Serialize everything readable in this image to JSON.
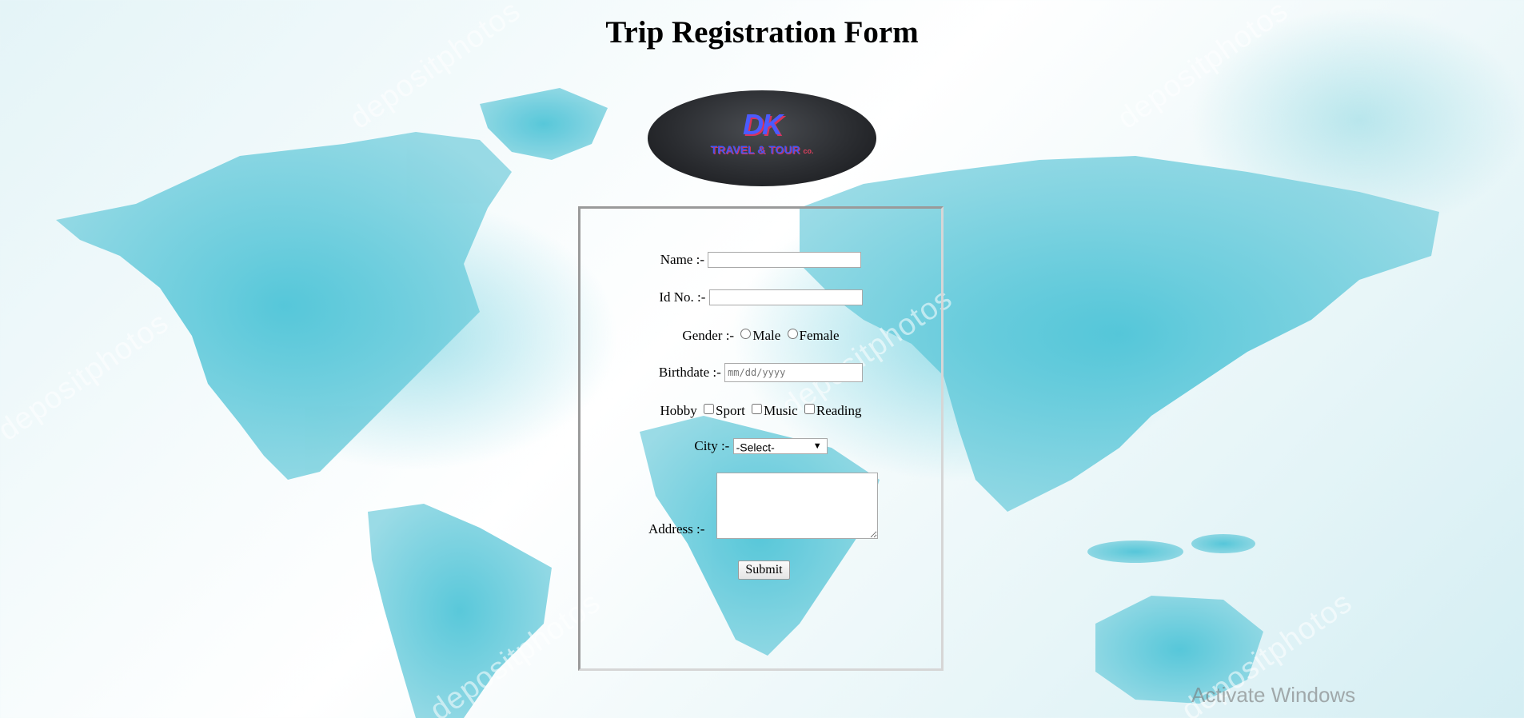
{
  "page": {
    "title": "Trip Registration Form"
  },
  "logo": {
    "mark": "DK",
    "subtitle": "TRAVEL & TOUR",
    "suffix": "co."
  },
  "form": {
    "name_label": "Name :-",
    "name_value": "",
    "id_label": "Id No. :-",
    "id_value": "",
    "gender_label": "Gender :-",
    "gender_options": [
      "Male",
      "Female"
    ],
    "birthdate_label": "Birthdate :-",
    "birthdate_placeholder": "mm/dd/yyyy",
    "hobby_label": "Hobby",
    "hobby_options": [
      "Sport",
      "Music",
      "Reading"
    ],
    "city_label": "City :-",
    "city_selected": "-Select-",
    "address_label": "Address :-",
    "address_value": "",
    "submit_label": "Submit"
  },
  "overlay": {
    "watermark_text": "depositphotos",
    "os_notice": "Activate Windows"
  },
  "colors": {
    "map_fill": "#5cc7d9",
    "background": "#eaf6f8",
    "logo_bg": "#2b2d31",
    "logo_mark": "#4b5bff",
    "logo_accent": "#d8335a"
  }
}
